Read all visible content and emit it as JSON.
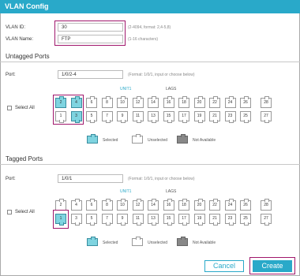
{
  "title": "VLAN Config",
  "vlan_id": {
    "label": "VLAN ID:",
    "value": "30",
    "hint": "(2-4094, format: 2,4-5,8)"
  },
  "vlan_name": {
    "label": "VLAN Name:",
    "value": "FTP",
    "hint": "(1-16 characters)"
  },
  "untagged": {
    "title": "Untagged Ports",
    "port_label": "Port:",
    "port_value": "1/0/2-4",
    "port_hint": "(Format: 1/0/1, input or choose below)",
    "unit_label": "UNIT1",
    "lags_label": "LAGS",
    "select_all": "Select All",
    "top_row": [
      "2",
      "4",
      "6",
      "8",
      "10",
      "12",
      "14",
      "16",
      "18",
      "20",
      "22",
      "24",
      "26"
    ],
    "bottom_row": [
      "1",
      "3",
      "5",
      "7",
      "9",
      "11",
      "13",
      "15",
      "17",
      "19",
      "21",
      "23",
      "25",
      "27"
    ],
    "top_lag": "28",
    "selected": [
      "2",
      "3",
      "4"
    ]
  },
  "tagged": {
    "title": "Tagged Ports",
    "port_label": "Port:",
    "port_value": "1/0/1",
    "port_hint": "(Format: 1/0/1, input or choose below)",
    "unit_label": "UNIT1",
    "lags_label": "LAGS",
    "select_all": "Select All",
    "top_row": [
      "2",
      "4",
      "6",
      "8",
      "10",
      "12",
      "14",
      "16",
      "18",
      "20",
      "22",
      "24",
      "26"
    ],
    "bottom_row": [
      "1",
      "3",
      "5",
      "7",
      "9",
      "11",
      "13",
      "15",
      "17",
      "19",
      "21",
      "23",
      "25",
      "27"
    ],
    "top_lag": "28",
    "selected": [
      "1"
    ]
  },
  "legend": {
    "selected": "Selected",
    "unselected": "Unselected",
    "not_available": "Not Available"
  },
  "buttons": {
    "cancel": "Cancel",
    "create": "Create"
  },
  "colors": {
    "accent": "#29a9c9",
    "selected_port": "#7fd4e0",
    "highlight": "#a0176c",
    "not_available": "#888888"
  }
}
